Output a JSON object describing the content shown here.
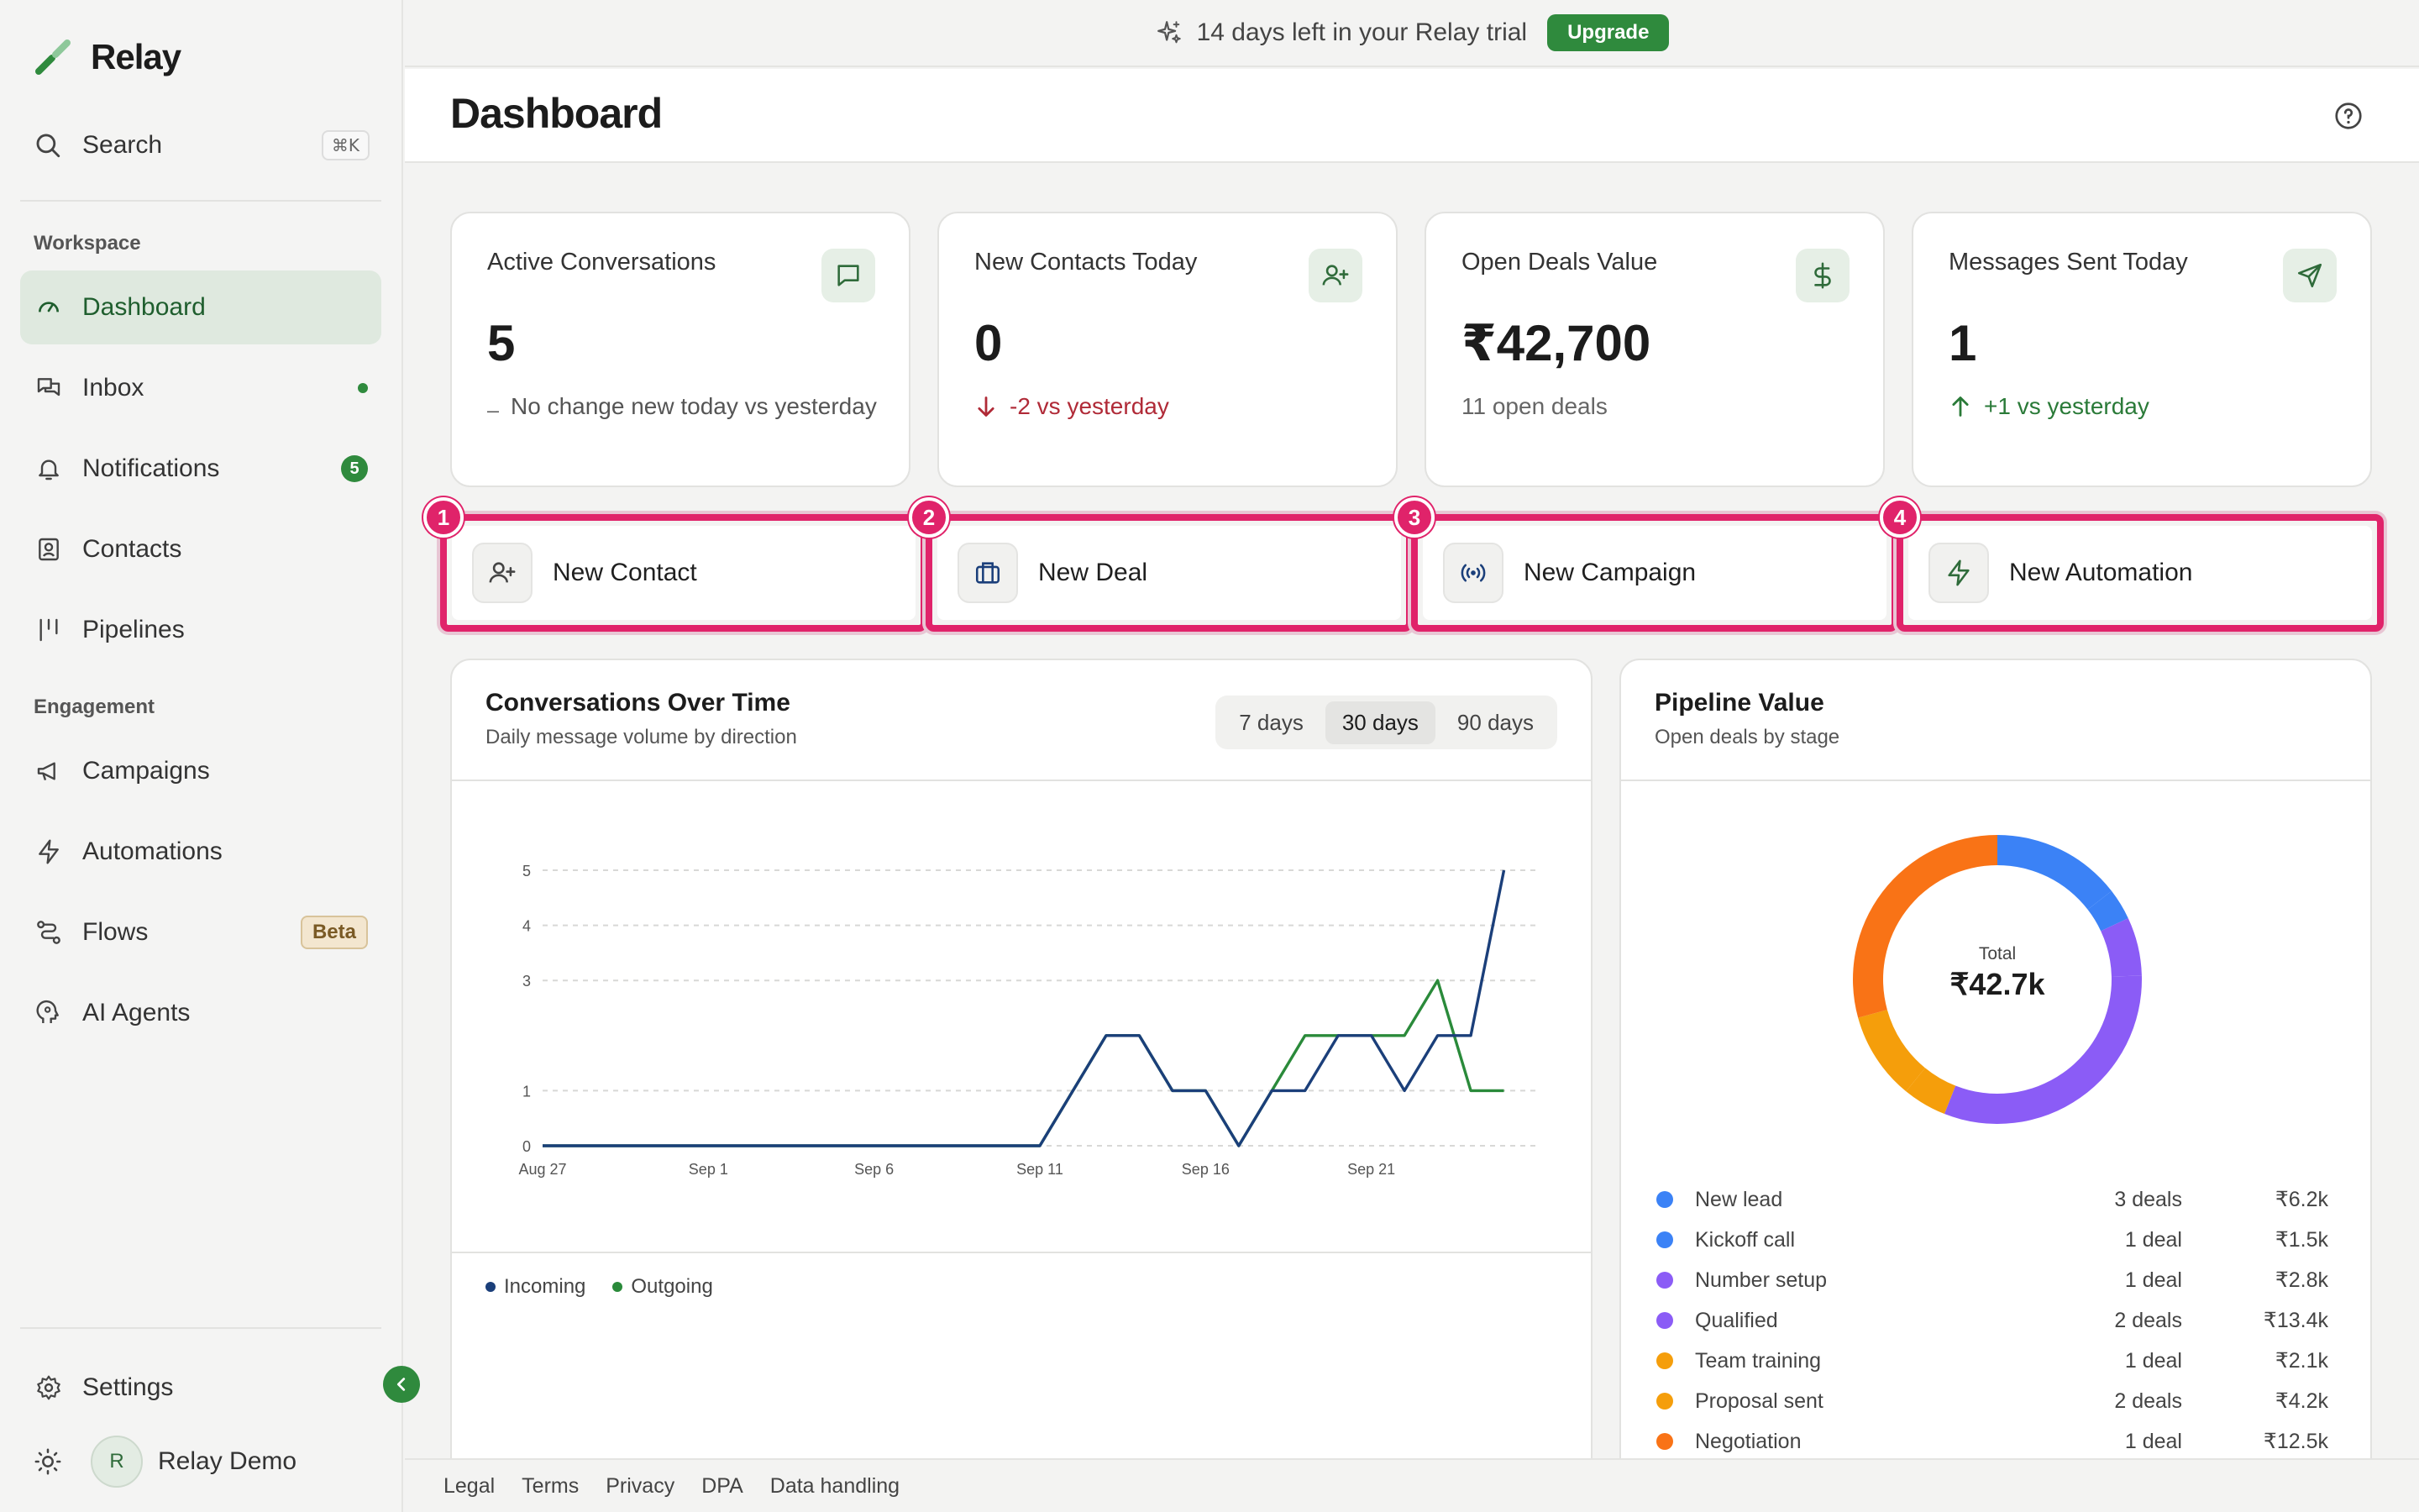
{
  "app": {
    "name": "Relay"
  },
  "sidebar": {
    "search": {
      "label": "Search",
      "shortcut": "⌘K"
    },
    "sections": {
      "workspace": "Workspace",
      "engagement": "Engagement"
    },
    "items": [
      {
        "label": "Dashboard",
        "icon": "gauge-icon",
        "active": true
      },
      {
        "label": "Inbox",
        "icon": "chat-bubbles-icon",
        "badge": "dot"
      },
      {
        "label": "Notifications",
        "icon": "bell-icon",
        "count": "5"
      },
      {
        "label": "Contacts",
        "icon": "contact-card-icon"
      },
      {
        "label": "Pipelines",
        "icon": "pipeline-icon"
      },
      {
        "label": "Campaigns",
        "icon": "megaphone-icon"
      },
      {
        "label": "Automations",
        "icon": "lightning-icon"
      },
      {
        "label": "Flows",
        "icon": "flow-icon",
        "tag": "Beta"
      },
      {
        "label": "AI Agents",
        "icon": "robot-head-icon"
      }
    ],
    "settings": "Settings",
    "user": {
      "initial": "R",
      "name": "Relay Demo"
    }
  },
  "trial": {
    "text": "14 days left in your Relay trial",
    "cta": "Upgrade"
  },
  "header": {
    "title": "Dashboard"
  },
  "stats": [
    {
      "title": "Active Conversations",
      "value": "5",
      "sub": "No change new today vs yesterday",
      "trend": "neutral",
      "icon": "message-square-icon"
    },
    {
      "title": "New Contacts Today",
      "value": "0",
      "sub": "-2 vs yesterday",
      "trend": "down",
      "icon": "user-plus-icon"
    },
    {
      "title": "Open Deals Value",
      "value": "₹42,700",
      "sub": "11 open deals",
      "trend": "none",
      "icon": "dollar-icon"
    },
    {
      "title": "Messages Sent Today",
      "value": "1",
      "sub": "+1 vs yesterday",
      "trend": "up",
      "icon": "send-icon"
    }
  ],
  "quick_actions": [
    {
      "num": "1",
      "label": "New Contact",
      "icon": "user-plus-icon"
    },
    {
      "num": "2",
      "label": "New Deal",
      "icon": "briefcase-icon"
    },
    {
      "num": "3",
      "label": "New Campaign",
      "icon": "broadcast-icon"
    },
    {
      "num": "4",
      "label": "New Automation",
      "icon": "lightning-icon"
    }
  ],
  "conversations_panel": {
    "title": "Conversations Over Time",
    "subtitle": "Daily message volume by direction",
    "ranges": [
      "7 days",
      "30 days",
      "90 days"
    ],
    "active_range": "30 days",
    "legend": [
      "Incoming",
      "Outgoing"
    ]
  },
  "pipeline_panel": {
    "title": "Pipeline Value",
    "subtitle": "Open deals by stage",
    "total_label": "Total",
    "total_value": "₹42.7k"
  },
  "chart_data": [
    {
      "type": "line",
      "x": [
        "Aug 27",
        "Aug 28",
        "Aug 29",
        "Aug 30",
        "Aug 31",
        "Sep 1",
        "Sep 2",
        "Sep 3",
        "Sep 4",
        "Sep 5",
        "Sep 6",
        "Sep 7",
        "Sep 8",
        "Sep 9",
        "Sep 10",
        "Sep 11",
        "Sep 12",
        "Sep 13",
        "Sep 14",
        "Sep 15",
        "Sep 16",
        "Sep 17",
        "Sep 18",
        "Sep 19",
        "Sep 20",
        "Sep 21",
        "Sep 22",
        "Sep 23",
        "Sep 24",
        "Sep 25",
        "Sep 26"
      ],
      "x_ticks": [
        "Aug 27",
        "Sep 1",
        "Sep 6",
        "Sep 11",
        "Sep 16",
        "Sep 21"
      ],
      "y_ticks": [
        0,
        1,
        3,
        4,
        5
      ],
      "ylim": [
        0,
        5
      ],
      "series": [
        {
          "name": "Incoming",
          "color": "#1b3f7a",
          "values": [
            0,
            0,
            0,
            0,
            0,
            0,
            0,
            0,
            0,
            0,
            0,
            0,
            0,
            0,
            0,
            0,
            1,
            2,
            2,
            1,
            1,
            0,
            1,
            1,
            2,
            2,
            1,
            2,
            2,
            5
          ]
        },
        {
          "name": "Outgoing",
          "color": "#2a8a3a",
          "values": [
            0,
            0,
            0,
            0,
            0,
            0,
            0,
            0,
            0,
            0,
            0,
            0,
            0,
            0,
            0,
            0,
            1,
            2,
            2,
            1,
            1,
            0,
            1,
            2,
            2,
            2,
            2,
            3,
            1,
            1
          ]
        }
      ],
      "grid": true,
      "legend": "bottom-left"
    },
    {
      "type": "pie",
      "donut": true,
      "categories": [
        "New lead",
        "Kickoff call",
        "Number setup",
        "Qualified",
        "Team training",
        "Proposal sent",
        "Negotiation"
      ],
      "deals": [
        "3 deals",
        "1 deal",
        "1 deal",
        "2 deals",
        "1 deal",
        "2 deals",
        "1 deal"
      ],
      "labels": [
        "₹6.2k",
        "₹1.5k",
        "₹2.8k",
        "₹13.4k",
        "₹2.1k",
        "₹4.2k",
        "₹12.5k"
      ],
      "values": [
        6.2,
        1.5,
        2.8,
        13.4,
        2.1,
        4.2,
        12.5
      ],
      "colors": [
        "#3b82f6",
        "#3b82f6",
        "#8b5cf6",
        "#8b5cf6",
        "#f59e0b",
        "#f59e0b",
        "#f97316"
      ],
      "legend": "bottom"
    }
  ],
  "footer": [
    "Legal",
    "Terms",
    "Privacy",
    "DPA",
    "Data handling"
  ]
}
